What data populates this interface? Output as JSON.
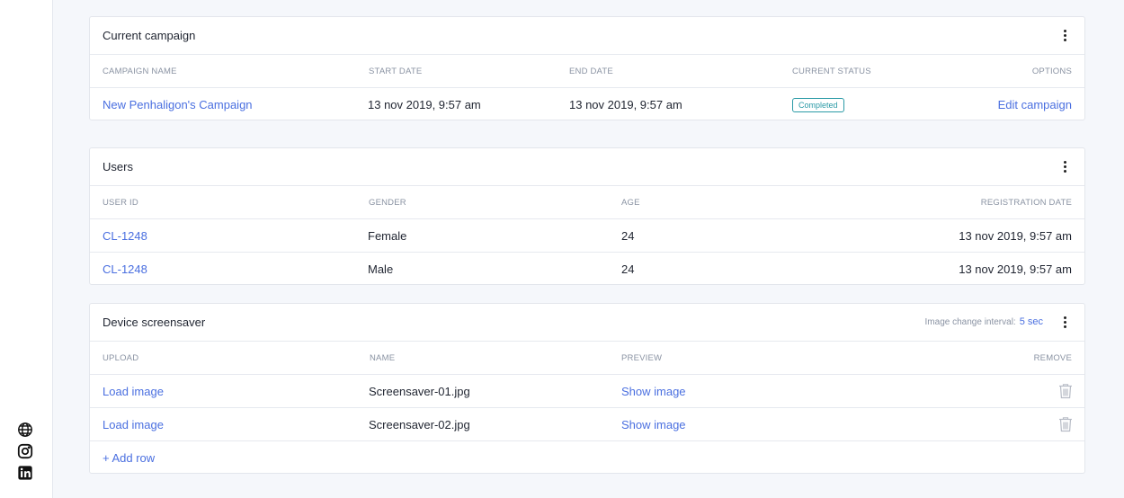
{
  "sidebar": {
    "social": [
      {
        "icon": "globe-icon"
      },
      {
        "icon": "instagram-icon"
      },
      {
        "icon": "linkedin-icon"
      }
    ]
  },
  "campaign": {
    "title": "Current campaign",
    "columns": [
      "CAMPAIGN NAME",
      "START DATE",
      "END DATE",
      "CURRENT STATUS",
      "OPTIONS"
    ],
    "row": {
      "name": "New Penhaligon's Campaign",
      "start": "13 nov 2019, 9:57 am",
      "end": "13 nov 2019, 9:57 am",
      "status": "Completed",
      "option": "Edit campaign"
    }
  },
  "users": {
    "title": "Users",
    "columns": [
      "USER ID",
      "GENDER",
      "AGE",
      "REGISTRATION DATE"
    ],
    "rows": [
      {
        "id": "CL-1248",
        "gender": "Female",
        "age": "24",
        "date": "13 nov 2019, 9:57 am"
      },
      {
        "id": "CL-1248",
        "gender": "Male",
        "age": "24",
        "date": "13 nov 2019, 9:57 am"
      }
    ]
  },
  "screensaver": {
    "title": "Device screensaver",
    "interval_label": "Image change interval:",
    "interval_value": "5 sec",
    "columns": [
      "UPLOAD",
      "NAME",
      "PREVIEW",
      "REMOVE"
    ],
    "rows": [
      {
        "upload": "Load image",
        "name": "Screensaver-01.jpg",
        "preview": "Show image"
      },
      {
        "upload": "Load image",
        "name": "Screensaver-02.jpg",
        "preview": "Show image"
      }
    ],
    "add_row": "+ Add row"
  },
  "colors": {
    "accent": "#4a6fe0",
    "status": "#2a9aa6",
    "background": "#f5f7fb"
  }
}
